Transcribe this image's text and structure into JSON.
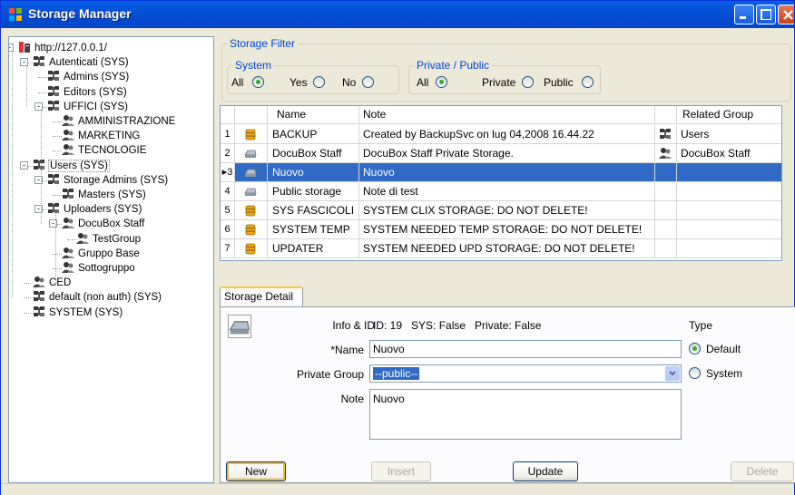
{
  "window": {
    "title": "Storage Manager"
  },
  "tree": {
    "nodes": [
      {
        "label": "http://127.0.0.1/",
        "icon": "server-icon"
      },
      {
        "label": "Autenticati (SYS)",
        "icon": "group-icon"
      },
      {
        "label": "Admins (SYS)",
        "icon": "group-icon"
      },
      {
        "label": "Editors (SYS)",
        "icon": "group-icon"
      },
      {
        "label": "UFFICI (SYS)",
        "icon": "group-icon"
      },
      {
        "label": "AMMINISTRAZIONE",
        "icon": "users-icon"
      },
      {
        "label": "MARKETING",
        "icon": "users-icon"
      },
      {
        "label": "TECNOLOGIE",
        "icon": "users-icon"
      },
      {
        "label": "Users (SYS)",
        "icon": "group-icon"
      },
      {
        "label": "Storage Admins (SYS)",
        "icon": "group-icon"
      },
      {
        "label": "Masters (SYS)",
        "icon": "group-icon"
      },
      {
        "label": "Uploaders (SYS)",
        "icon": "group-icon"
      },
      {
        "label": "DocuBox Staff",
        "icon": "users-icon"
      },
      {
        "label": "TestGroup",
        "icon": "users-icon"
      },
      {
        "label": "Gruppo Base",
        "icon": "users-icon"
      },
      {
        "label": "Sottogruppo",
        "icon": "users-icon"
      },
      {
        "label": "CED",
        "icon": "users-icon"
      },
      {
        "label": "default (non auth) (SYS)",
        "icon": "group-icon"
      },
      {
        "label": "SYSTEM (SYS)",
        "icon": "group-icon"
      }
    ]
  },
  "filter": {
    "title": "Storage Filter",
    "system": {
      "title": "System",
      "options": [
        {
          "label": "All",
          "checked": true
        },
        {
          "label": "Yes",
          "checked": false
        },
        {
          "label": "No",
          "checked": false
        }
      ]
    },
    "privacy": {
      "title": "Private / Public",
      "options": [
        {
          "label": "All",
          "checked": true
        },
        {
          "label": "Private",
          "checked": false
        },
        {
          "label": "Public",
          "checked": false
        }
      ]
    }
  },
  "grid": {
    "columns": [
      "Name",
      "Note",
      "Related Group"
    ],
    "rows": [
      {
        "num": "1",
        "icon": "database-icon",
        "name": "BACKUP",
        "note": "Created by BackupSvc on lug 04,2008 16.44.22",
        "group_icon": "group-icon",
        "group": "Users",
        "selected": false
      },
      {
        "num": "2",
        "icon": "storage-icon",
        "name": "DocuBox Staff",
        "note": "DocuBox Staff Private Storage.",
        "group_icon": "users-icon",
        "group": "DocuBox Staff",
        "selected": false
      },
      {
        "num": "3",
        "icon": "storage-icon",
        "name": "Nuovo",
        "note": "Nuovo",
        "group_icon": "",
        "group": "",
        "selected": true
      },
      {
        "num": "4",
        "icon": "storage-icon",
        "name": "Public storage",
        "note": "Note di test",
        "group_icon": "",
        "group": "",
        "selected": false
      },
      {
        "num": "5",
        "icon": "database-icon",
        "name": "SYS FASCICOLI",
        "note": "SYSTEM CLIX STORAGE: DO NOT DELETE!",
        "group_icon": "",
        "group": "",
        "selected": false
      },
      {
        "num": "6",
        "icon": "database-icon",
        "name": "SYSTEM TEMP",
        "note": "SYSTEM NEEDED TEMP STORAGE: DO NOT DELETE!",
        "group_icon": "",
        "group": "",
        "selected": false
      },
      {
        "num": "7",
        "icon": "database-icon",
        "name": "UPDATER",
        "note": "SYSTEM NEEDED UPD STORAGE: DO NOT DELETE!",
        "group_icon": "",
        "group": "",
        "selected": false
      }
    ]
  },
  "detail": {
    "tab_label": "Storage Detail",
    "info_label": "Info & ID",
    "info_value": "ID: 19   SYS: False   Private: False",
    "name_label": "*Name",
    "name_value": "Nuovo",
    "group_label": "Private Group",
    "group_value": "--public--",
    "note_label": "Note",
    "note_value": "Nuovo",
    "type_label": "Type",
    "type_options": [
      {
        "label": "Default",
        "checked": true
      },
      {
        "label": "System",
        "checked": false
      }
    ],
    "buttons": {
      "new": "New",
      "insert": "Insert",
      "update": "Update",
      "delete": "Delete"
    }
  },
  "colors": {
    "selection": "#316ac5",
    "titlebar": "#0350d6",
    "group_title": "#0046d5"
  }
}
